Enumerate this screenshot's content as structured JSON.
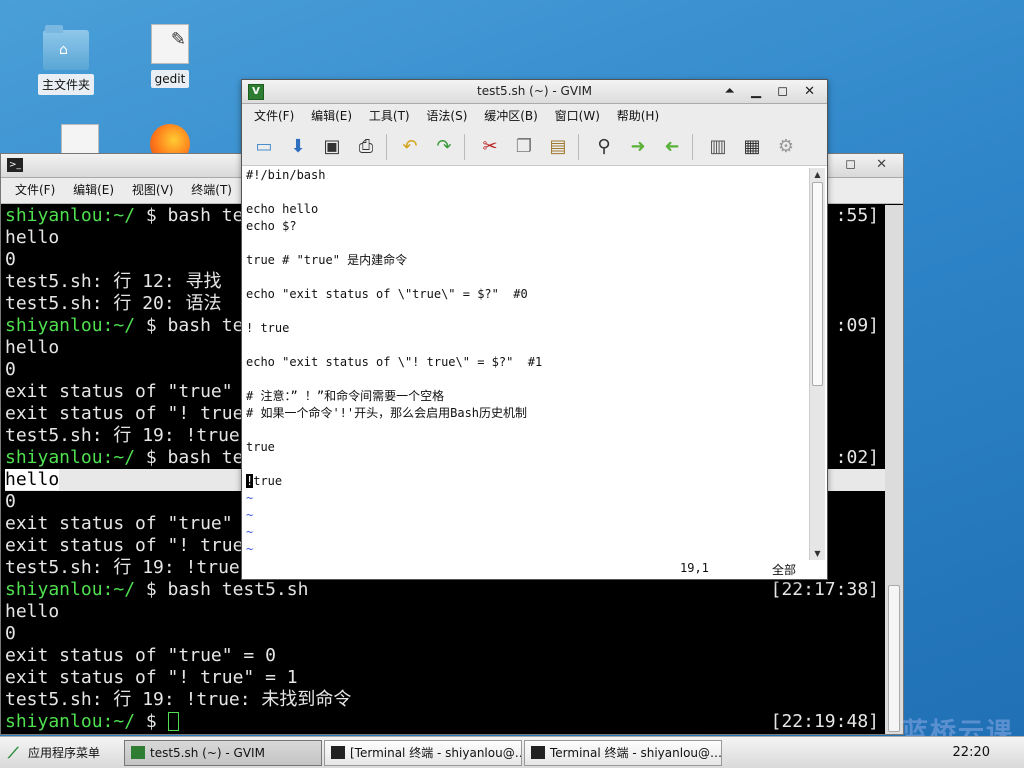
{
  "desktop": {
    "icons": [
      {
        "label": "主文件夹"
      },
      {
        "label": "gedit"
      }
    ]
  },
  "terminal": {
    "menu": [
      "文件(F)",
      "编辑(E)",
      "视图(V)",
      "终端(T)",
      "标"
    ],
    "lines": [
      {
        "prompt": "shiyanlou:~/",
        "text": " $ bash te",
        "ts": ":55]"
      },
      {
        "text": "hello"
      },
      {
        "text": "0"
      },
      {
        "text": "test5.sh: 行 12: 寻找"
      },
      {
        "text": "test5.sh: 行 20: 语法"
      },
      {
        "prompt": "shiyanlou:~/",
        "text": " $ bash te",
        "ts": ":09]"
      },
      {
        "text": "hello"
      },
      {
        "text": "0"
      },
      {
        "text": "exit status of \"true\""
      },
      {
        "text": "exit status of \"! true"
      },
      {
        "text": "test5.sh: 行 19: !true"
      },
      {
        "prompt": "shiyanlou:~/",
        "text": " $ bash te",
        "ts": ":02]"
      },
      {
        "text": "hello",
        "highlight": true
      },
      {
        "text": "0"
      },
      {
        "text": "exit status of \"true\""
      },
      {
        "text": "exit status of \"! true"
      },
      {
        "text": "test5.sh: 行 19: !true"
      },
      {
        "prompt": "shiyanlou:~/",
        "text": " $ bash test5.sh",
        "ts": "[22:17:38]"
      },
      {
        "text": "hello"
      },
      {
        "text": "0"
      },
      {
        "text": "exit status of \"true\" = 0"
      },
      {
        "text": "exit status of \"! true\" = 1"
      },
      {
        "text": "test5.sh: 行 19: !true: 未找到命令"
      },
      {
        "prompt": "shiyanlou:~/",
        "text": " $ ",
        "ts": "[22:19:48]",
        "cursor": true
      }
    ]
  },
  "gvim": {
    "title": "test5.sh (~) - GVIM",
    "menu": [
      "文件(F)",
      "编辑(E)",
      "工具(T)",
      "语法(S)",
      "缓冲区(B)",
      "窗口(W)",
      "帮助(H)"
    ],
    "lines": [
      "#!/bin/bash",
      "",
      "echo hello",
      "echo $?",
      "",
      "true # \"true\" 是内建命令",
      "",
      "echo \"exit status of \\\"true\\\" = $?\"  #0",
      "",
      "! true",
      "",
      "echo \"exit status of \\\"! true\\\" = $?\"  #1",
      "",
      "# 注意：” ！”和命令间需要一个空格",
      "# 如果一个命令'!'开头，那么会启用Bash历史机制",
      "",
      "true",
      "",
      "!true"
    ],
    "cursor_char": "!",
    "cursor_rest": "true",
    "tilde_lines": [
      "~",
      "~",
      "~",
      "~"
    ],
    "status_pos": "19,1",
    "status_pct": "全部"
  },
  "taskbar": {
    "start_label": "应用程序菜单",
    "tasks": [
      {
        "label": "test5.sh (~) - GVIM",
        "active": true
      },
      {
        "label": "[Terminal 终端 - shiyanlou@…"
      },
      {
        "label": "Terminal 终端 - shiyanlou@…"
      }
    ],
    "clock": "22:20"
  },
  "watermark": "蓝桥云课"
}
